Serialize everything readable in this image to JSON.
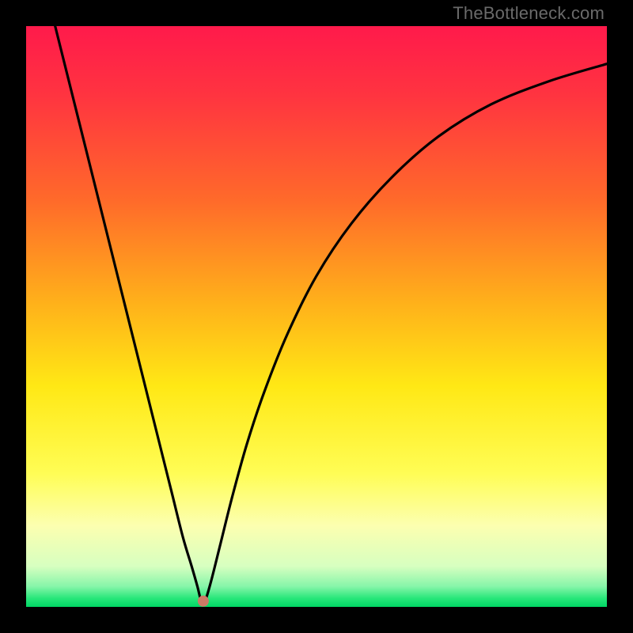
{
  "watermark": "TheBottleneck.com",
  "chart_data": {
    "type": "line",
    "title": "",
    "xlabel": "",
    "ylabel": "",
    "xlim": [
      0,
      100
    ],
    "ylim": [
      0,
      100
    ],
    "gradient_stops": [
      {
        "offset": 0,
        "color": "#ff1a4b"
      },
      {
        "offset": 0.12,
        "color": "#ff3440"
      },
      {
        "offset": 0.3,
        "color": "#ff6a2a"
      },
      {
        "offset": 0.48,
        "color": "#ffb21a"
      },
      {
        "offset": 0.62,
        "color": "#ffe815"
      },
      {
        "offset": 0.77,
        "color": "#fffd55"
      },
      {
        "offset": 0.86,
        "color": "#fcffb0"
      },
      {
        "offset": 0.93,
        "color": "#d7ffc0"
      },
      {
        "offset": 0.965,
        "color": "#86f5a9"
      },
      {
        "offset": 0.985,
        "color": "#28e77a"
      },
      {
        "offset": 1.0,
        "color": "#00d664"
      }
    ],
    "marker": {
      "x": 30.5,
      "y": 1.0,
      "color": "#cc7a66"
    },
    "series": [
      {
        "name": "curve",
        "x": [
          5,
          7,
          9,
          11,
          13,
          15,
          17,
          19,
          21,
          23,
          25,
          27,
          28.5,
          29.5,
          30,
          30.5,
          31,
          32,
          33.5,
          35.5,
          38,
          41,
          45,
          50,
          56,
          63,
          71,
          80,
          90,
          100
        ],
        "y": [
          100,
          92,
          84,
          76,
          68,
          60,
          52,
          44,
          36,
          28,
          20,
          12,
          7,
          3.5,
          1.5,
          0.5,
          1.5,
          5,
          11,
          19,
          28,
          37,
          47,
          57,
          66,
          74,
          81,
          86.5,
          90.5,
          93.5
        ]
      }
    ]
  }
}
